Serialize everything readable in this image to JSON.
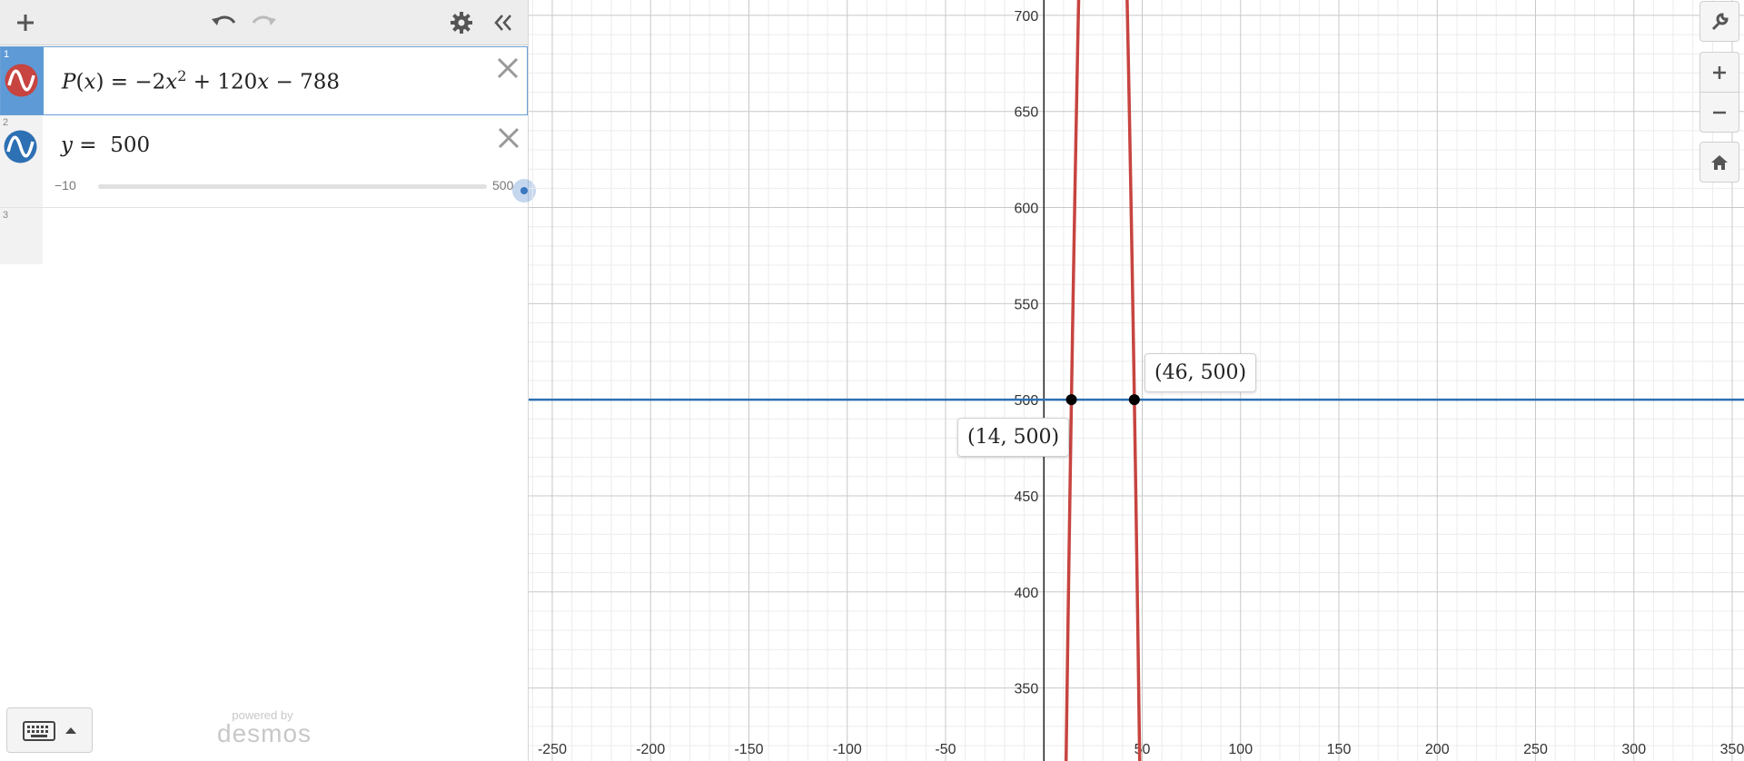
{
  "expressions": [
    {
      "index": "1",
      "func": "P",
      "var": "x",
      "coef_a": "−2",
      "sq_var": "x",
      "exponent": "2",
      "plus": "+",
      "term_b": "120",
      "b_var": "x",
      "minus": "−",
      "const_c": "788",
      "color": "#c74440"
    },
    {
      "index": "2",
      "lhs": "y",
      "rhs": "500",
      "color": "#2d70b3",
      "slider": {
        "min": "−10",
        "max": "500",
        "value": 500
      }
    },
    {
      "index": "3"
    }
  ],
  "graph": {
    "x_ticks": [
      "-250",
      "-200",
      "-150",
      "-100",
      "-50",
      "50",
      "100",
      "150",
      "200",
      "250",
      "300",
      "350"
    ],
    "y_ticks": [
      "700",
      "650",
      "600",
      "550",
      "500",
      "450",
      "400",
      "350"
    ],
    "x_range": [
      -262,
      356
    ],
    "y_range": [
      312,
      708
    ],
    "curve": {
      "a": -2,
      "b": 120,
      "c": -788,
      "color": "#c74440"
    },
    "hline": {
      "y": 500,
      "color": "#2d70b3"
    },
    "points": [
      {
        "x": 14,
        "y": 500,
        "label": "(14, 500)"
      },
      {
        "x": 46,
        "y": 500,
        "label": "(46, 500)"
      }
    ]
  },
  "branding": {
    "powered_by": "powered by",
    "name": "desmos"
  }
}
